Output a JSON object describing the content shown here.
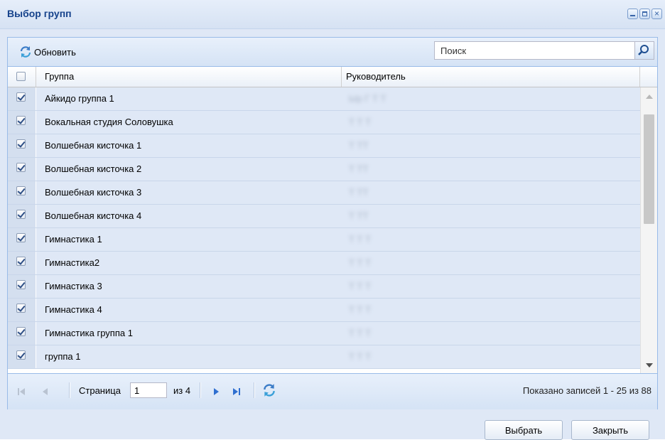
{
  "window": {
    "title": "Выбор групп",
    "controls": [
      "minimize-icon",
      "maximize-icon",
      "close-icon"
    ]
  },
  "toolbar": {
    "refresh_label": "Обновить",
    "refresh_icon": "refresh-icon",
    "search_placeholder": "Поиск",
    "search_icon": "search-icon"
  },
  "grid": {
    "columns": [
      "Группа",
      "Руководитель"
    ],
    "rows": [
      {
        "checked": true,
        "group": "Айкидо группа 1",
        "leader": "Ыр  Г  Т    Т  "
      },
      {
        "checked": true,
        "group": "Вокальная студия Соловушка",
        "leader": "Т   Т  Т  "
      },
      {
        "checked": true,
        "group": "Волшебная кисточка 1",
        "leader": "Т    ТТ  "
      },
      {
        "checked": true,
        "group": "Волшебная кисточка 2",
        "leader": "Т    ТТ  "
      },
      {
        "checked": true,
        "group": "Волшебная кисточка 3",
        "leader": "Т    ТТ  "
      },
      {
        "checked": true,
        "group": "Волшебная кисточка 4",
        "leader": "Т    ТТ  "
      },
      {
        "checked": true,
        "group": "Гимнастика 1",
        "leader": "Т    Т  Т"
      },
      {
        "checked": true,
        "group": "Гимнастика2",
        "leader": "Т    Т  Т"
      },
      {
        "checked": true,
        "group": "Гимнастика 3",
        "leader": "Т    Т  Т"
      },
      {
        "checked": true,
        "group": "Гимнастика 4",
        "leader": "Т    Т  Т"
      },
      {
        "checked": true,
        "group": "Гимнастика группа 1",
        "leader": "Т    Т  Т"
      },
      {
        "checked": true,
        "group": "группа 1",
        "leader": "Т    Т  Т"
      }
    ]
  },
  "paging": {
    "page_label": "Страница",
    "page_value": "1",
    "of_label": "из 4",
    "status": "Показано записей 1 - 25 из 88"
  },
  "footer": {
    "select_label": "Выбрать",
    "close_label": "Закрыть"
  }
}
